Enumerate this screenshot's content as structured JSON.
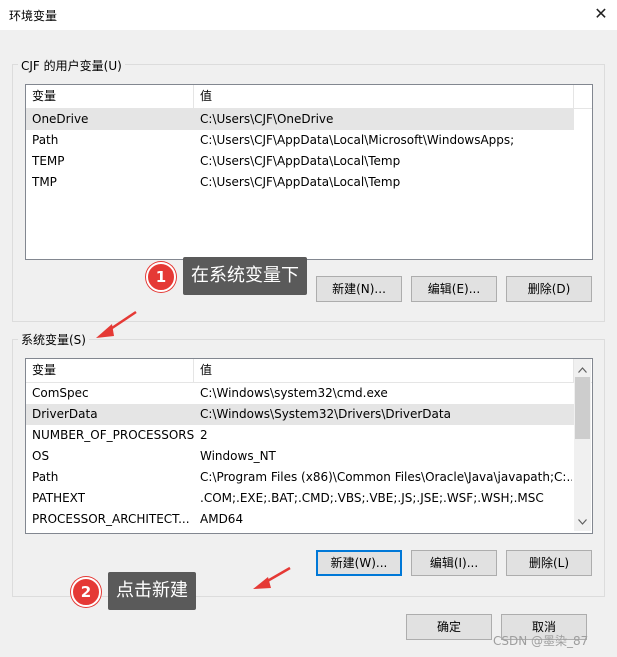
{
  "window": {
    "title": "环境变量",
    "close_glyph": "✕"
  },
  "user_vars": {
    "group_label": "CJF 的用户变量(U)",
    "col_var": "变量",
    "col_val": "值",
    "rows": [
      {
        "name": "OneDrive",
        "value": "C:\\Users\\CJF\\OneDrive"
      },
      {
        "name": "Path",
        "value": "C:\\Users\\CJF\\AppData\\Local\\Microsoft\\WindowsApps;"
      },
      {
        "name": "TEMP",
        "value": "C:\\Users\\CJF\\AppData\\Local\\Temp"
      },
      {
        "name": "TMP",
        "value": "C:\\Users\\CJF\\AppData\\Local\\Temp"
      }
    ],
    "btn_new": "新建(N)...",
    "btn_edit": "编辑(E)...",
    "btn_delete": "删除(D)"
  },
  "sys_vars": {
    "group_label": "系统变量(S)",
    "col_var": "变量",
    "col_val": "值",
    "rows": [
      {
        "name": "ComSpec",
        "value": "C:\\Windows\\system32\\cmd.exe"
      },
      {
        "name": "DriverData",
        "value": "C:\\Windows\\System32\\Drivers\\DriverData"
      },
      {
        "name": "NUMBER_OF_PROCESSORS",
        "value": "2"
      },
      {
        "name": "OS",
        "value": "Windows_NT"
      },
      {
        "name": "Path",
        "value": "C:\\Program Files (x86)\\Common Files\\Oracle\\Java\\javapath;C:..."
      },
      {
        "name": "PATHEXT",
        "value": ".COM;.EXE;.BAT;.CMD;.VBS;.VBE;.JS;.JSE;.WSF;.WSH;.MSC"
      },
      {
        "name": "PROCESSOR_ARCHITECT...",
        "value": "AMD64"
      }
    ],
    "btn_new": "新建(W)...",
    "btn_edit": "编辑(I)...",
    "btn_delete": "删除(L)"
  },
  "footer": {
    "ok": "确定",
    "cancel": "取消"
  },
  "annotations": {
    "step1_number": "1",
    "step1_text": "在系统变量下",
    "step2_number": "2",
    "step2_text": "点击新建",
    "accent_color": "#e53935"
  },
  "watermark": "CSDN @墨染_87"
}
